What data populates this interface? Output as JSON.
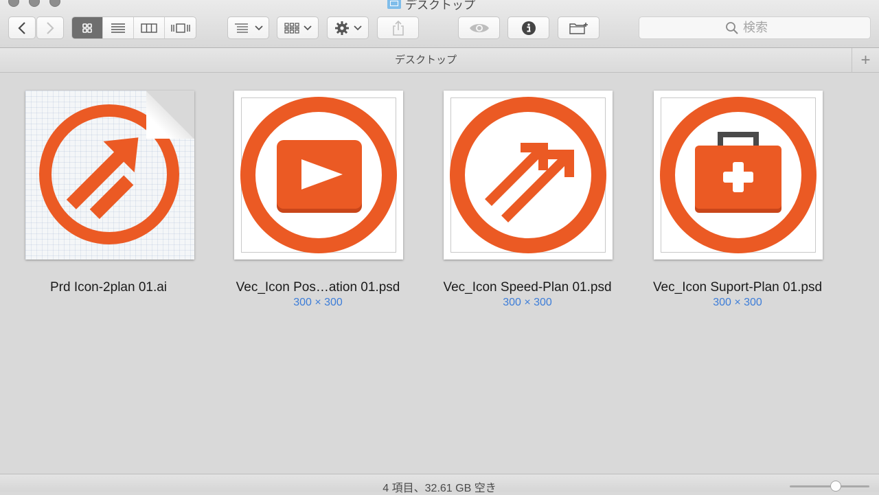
{
  "window": {
    "title": "デスクトップ"
  },
  "toolbar": {
    "back_icon": "chevron-left-icon",
    "forward_icon": "chevron-right-icon",
    "view_modes": [
      "icon-view",
      "list-view",
      "column-view",
      "cover-flow-view"
    ],
    "active_view": "icon-view",
    "arrange_icon": "arrange-icon",
    "group_icon": "grid-icon",
    "action_icon": "gear-icon",
    "share_icon": "share-icon",
    "quicklook_icon": "eye-icon",
    "info_icon": "info-icon",
    "new_folder_icon": "new-folder-icon"
  },
  "search": {
    "placeholder": "検索"
  },
  "pathbar": {
    "title": "デスクトップ",
    "add_label": "+"
  },
  "files": [
    {
      "name": "Prd Icon-2plan 01.ai",
      "size": "",
      "icon": "speed-arrows-icon",
      "kind": "ai"
    },
    {
      "name": "Vec_Icon Pos…ation 01.psd",
      "size": "300 × 300",
      "icon": "play-icon",
      "kind": "psd"
    },
    {
      "name": "Vec_Icon Speed-Plan 01.psd",
      "size": "300 × 300",
      "icon": "speed-arrows-icon",
      "kind": "psd"
    },
    {
      "name": "Vec_Icon Suport-Plan 01.psd",
      "size": "300 × 300",
      "icon": "medical-kit-icon",
      "kind": "psd"
    }
  ],
  "status": {
    "text": "4 項目、32.61 GB 空き"
  },
  "icon_size_slider": {
    "value": 0.6
  },
  "colors": {
    "accent_orange": "#eb5a24",
    "size_label": "#3d7dd8"
  }
}
